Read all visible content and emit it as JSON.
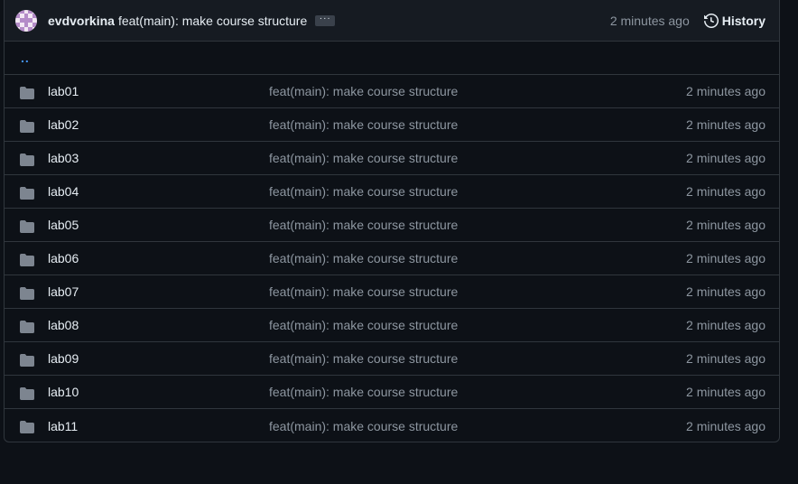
{
  "header": {
    "author": "evdvorkina",
    "commit_message": "feat(main): make course structure",
    "ellipsis": "···",
    "time": "2 minutes ago",
    "history_label": "History"
  },
  "parent_dir_label": "..",
  "rows": [
    {
      "name": "lab01",
      "message": "feat(main): make course structure",
      "time": "2 minutes ago"
    },
    {
      "name": "lab02",
      "message": "feat(main): make course structure",
      "time": "2 minutes ago"
    },
    {
      "name": "lab03",
      "message": "feat(main): make course structure",
      "time": "2 minutes ago"
    },
    {
      "name": "lab04",
      "message": "feat(main): make course structure",
      "time": "2 minutes ago"
    },
    {
      "name": "lab05",
      "message": "feat(main): make course structure",
      "time": "2 minutes ago"
    },
    {
      "name": "lab06",
      "message": "feat(main): make course structure",
      "time": "2 minutes ago"
    },
    {
      "name": "lab07",
      "message": "feat(main): make course structure",
      "time": "2 minutes ago"
    },
    {
      "name": "lab08",
      "message": "feat(main): make course structure",
      "time": "2 minutes ago"
    },
    {
      "name": "lab09",
      "message": "feat(main): make course structure",
      "time": "2 minutes ago"
    },
    {
      "name": "lab10",
      "message": "feat(main): make course structure",
      "time": "2 minutes ago"
    },
    {
      "name": "lab11",
      "message": "feat(main): make course structure",
      "time": "2 minutes ago"
    }
  ],
  "icons": {
    "folder": "folder-icon",
    "history": "history-icon",
    "avatar": "avatar"
  },
  "colors": {
    "background": "#0d1117",
    "header_background": "#161b22",
    "border": "#30363d",
    "link": "#4493f8",
    "muted_text": "#8d96a0",
    "folder": "#7d8590"
  }
}
